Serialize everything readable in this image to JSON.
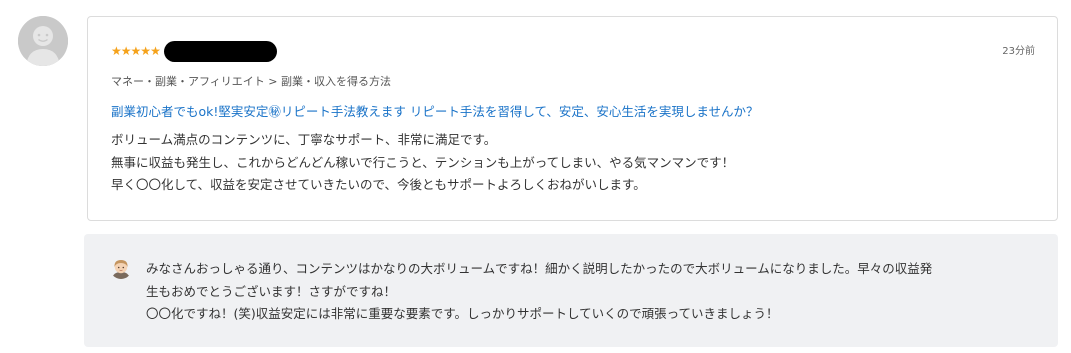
{
  "review": {
    "rating_icon": "star-icon",
    "rating_count": 5,
    "stars": [
      "★",
      "★",
      "★",
      "★",
      "★"
    ],
    "timestamp": "23分前",
    "category": "マネー・副業・アフィリエイト > 副業・収入を得る方法",
    "product_title": "副業初心者でもok!堅実安定㊙リピート手法教えます リピート手法を習得して、安定、安心生活を実現しませんか？",
    "body_lines": [
      "ボリューム満点のコンテンツに、丁寧なサポート、非常に満足です。",
      "無事に収益も発生し、これからどんどん稼いで行こうと、テンションも上がってしまい、やる気マンマンです！",
      "早く〇〇化して、収益を安定させていきたいので、今後ともサポートよろしくおねがいします。"
    ]
  },
  "reply": {
    "lines": [
      "みなさんおっしゃる通り、コンテンツはかなりの大ボリュームですね！細かく説明したかったので大ボリュームになりました。早々の収益発",
      "生もおめでとうございます！さすがですね！",
      "〇〇化ですね！(笑)収益安定には非常に重要な要素です。しっかりサポートしていくので頑張っていきましょう！"
    ]
  },
  "colors": {
    "star": "#f5a21b",
    "link": "#1a73c8",
    "reply_bg": "#f0f1f3",
    "card_border": "#dcdcdc"
  }
}
